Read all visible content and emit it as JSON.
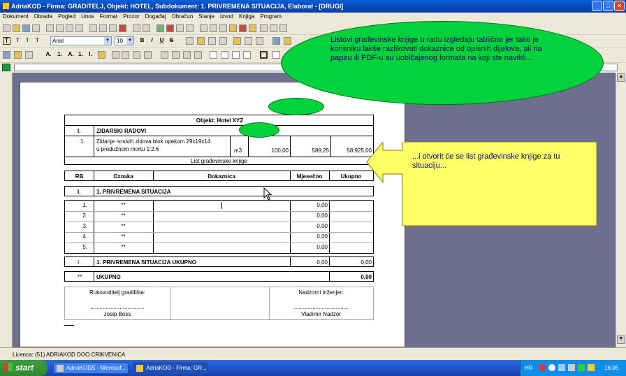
{
  "window": {
    "title": "AdriaKOD - Firma: GRADITELJ,  Objekt: HOTEL,  Subdokument: 1. PRIVREMENA SITUACIJA,  Elaborat - [DRUGI]"
  },
  "menu": [
    "Dokument",
    "Obrada",
    "Pogled",
    "Unos",
    "Format",
    "Prozor",
    "Događaj",
    "Obračun",
    "Stanje",
    "Izvod",
    "Knjiga",
    "Program"
  ],
  "format_toolbar": {
    "font": "Arial",
    "size": "10",
    "bold": "B",
    "italic": "I",
    "underline": "U",
    "strike": "S"
  },
  "style_toolbar": {
    "glyphs": [
      "T",
      "T",
      "T",
      "T"
    ]
  },
  "numbering_toolbar": {
    "items": [
      "A.",
      "1.",
      "A.",
      "1.",
      "I."
    ]
  },
  "document": {
    "object_title": "Objekt: Hotel XYZ",
    "section_no": "I.",
    "section_name": "ZIDARSKI RADOVI",
    "item": {
      "no": "1.",
      "desc1": "Zidanje nosivih zidova blok opekom 29x19x14",
      "desc2": "u produžnom mortu 1:2:6",
      "unit": "m3",
      "qty": "100,00",
      "price": "589,25",
      "total": "58.925,00"
    },
    "list_caption": "List građevinske knjige",
    "headers": [
      "RB",
      "Oznaka",
      "Dokaznica",
      "Mjesečno",
      "Ukupno"
    ],
    "situation_no": "I.",
    "situation_name": "1. PRIVREMENA SITUACIJA",
    "rows": [
      {
        "rb": "1.",
        "oznaka": "**",
        "mj": "0,00"
      },
      {
        "rb": "2.",
        "oznaka": "**",
        "mj": "0,00"
      },
      {
        "rb": "3.",
        "oznaka": "**",
        "mj": "0,00"
      },
      {
        "rb": "4.",
        "oznaka": "**",
        "mj": "0,00"
      },
      {
        "rb": "5.",
        "oznaka": "**",
        "mj": "0,00"
      }
    ],
    "total_row": {
      "no": "I.",
      "name": "1. PRIVREMENA SITUACIJA UKUPNO",
      "mj": "0,00",
      "uk": "0,00"
    },
    "grand_row": {
      "no": "**",
      "name": "UKUPNO",
      "uk": "0,00"
    },
    "sign_left": {
      "role": "Rukovoditelj gradilišta:",
      "dots": "...................................",
      "name": "Josip Boss"
    },
    "sign_right": {
      "role": "Nadzorni inženjer:",
      "dots": "...................................",
      "name": "Vladimir Nadzor"
    }
  },
  "callouts": {
    "top": "Listovi građevinske knjige u radu izgledaju tablično jer tako je korisniku lakše razlikovati dokaznice od opisnih dijelova, ali na papiru ili PDF-u su uobičajenog formata na koji ste navikli...",
    "right": "...i otvorit će se list građevinske knjige za tu situaciju..."
  },
  "status": {
    "license": "Licenca: (51) ADRIAKOD DOO CRIKVENICA"
  },
  "taskbar": {
    "start": "start",
    "tasks": [
      "AdriaKODS - Microsof...",
      "AdriaKOD - Firma: GR..."
    ],
    "lang": "HR",
    "clock": "16:06"
  },
  "colors": {
    "callout_green": "#00d23c",
    "callout_yellow": "#ffff66",
    "title_blue": "#0a5fd8"
  }
}
